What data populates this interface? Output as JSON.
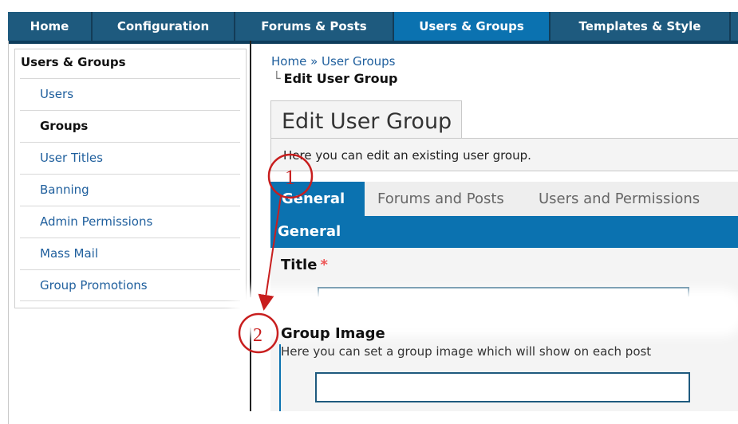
{
  "nav": {
    "tabs": [
      {
        "label": "Home"
      },
      {
        "label": "Configuration"
      },
      {
        "label": "Forums & Posts"
      },
      {
        "label": "Users & Groups"
      },
      {
        "label": "Templates & Style"
      }
    ],
    "active_index": 3
  },
  "sidebar": {
    "title": "Users & Groups",
    "items": [
      {
        "label": "Users"
      },
      {
        "label": "Groups"
      },
      {
        "label": "User Titles"
      },
      {
        "label": "Banning"
      },
      {
        "label": "Admin Permissions"
      },
      {
        "label": "Mass Mail"
      },
      {
        "label": "Group Promotions"
      }
    ],
    "active_index": 1
  },
  "breadcrumb": {
    "home": "Home",
    "separator": "»",
    "section": "User Groups",
    "current": "Edit User Group"
  },
  "panel": {
    "title": "Edit User Group",
    "description": "Here you can edit an existing user group.",
    "tabs": [
      {
        "label": "General"
      },
      {
        "label": "Forums and Posts"
      },
      {
        "label": "Users and Permissions"
      }
    ],
    "active_tab": 0,
    "section_header": "General"
  },
  "form": {
    "title_label": "Title",
    "required_marker": "*",
    "title_value": "",
    "group_image_label": "Group Image",
    "group_image_description": "Here you can set a group image which will show on each post",
    "group_image_value": ""
  },
  "annotations": {
    "marker_1": "1",
    "marker_2": "2"
  },
  "colors": {
    "nav_bg": "#1e5a7e",
    "accent": "#0b72b0",
    "link": "#1f5f9d",
    "annotation": "#c81e1e"
  }
}
